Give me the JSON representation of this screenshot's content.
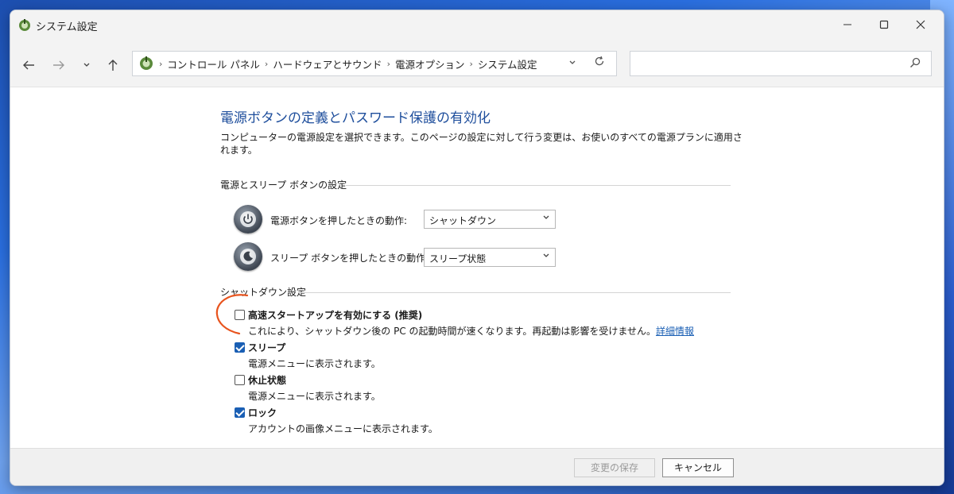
{
  "window": {
    "title": "システム設定",
    "app_icon": "power-options-icon",
    "controls": [
      "minimize-icon",
      "maximize-icon",
      "close-icon"
    ]
  },
  "nav": {
    "back_icon": "arrow-left-icon",
    "forward_icon": "arrow-right-icon",
    "recent_icon": "chevron-down-icon",
    "up_icon": "arrow-up-icon",
    "breadcrumb": [
      "コントロール パネル",
      "ハードウェアとサウンド",
      "電源オプション",
      "システム設定"
    ],
    "search_placeholder": ""
  },
  "main": {
    "title": "電源ボタンの定義とパスワード保護の有効化",
    "description": "コンピューターの電源設定を選択できます。このページの設定に対して行う変更は、お使いのすべての電源プランに適用されます。",
    "power_section": {
      "heading": "電源とスリープ ボタンの設定",
      "power_button_label": "電源ボタンを押したときの動作:",
      "power_button_value": "シャットダウン",
      "sleep_button_label": "スリープ ボタンを押したときの動作:",
      "sleep_button_value": "スリープ状態"
    },
    "shutdown_section": {
      "heading": "シャットダウン設定",
      "options": [
        {
          "title": "高速スタートアップを有効にする (推奨)",
          "desc": "これにより、シャットダウン後の PC の起動時間が速くなります。再起動は影響を受けません。",
          "link": "詳細情報",
          "checked": false
        },
        {
          "title": "スリープ",
          "desc": "電源メニューに表示されます。",
          "checked": true
        },
        {
          "title": "休止状態",
          "desc": "電源メニューに表示されます。",
          "checked": false
        },
        {
          "title": "ロック",
          "desc": "アカウントの画像メニューに表示されます。",
          "checked": true
        }
      ]
    }
  },
  "footer": {
    "save_label": "変更の保存",
    "cancel_label": "キャンセル"
  },
  "colors": {
    "accent": "#1a5fb4",
    "title_blue": "#1e4e9c",
    "annotation": "#e8541e"
  }
}
